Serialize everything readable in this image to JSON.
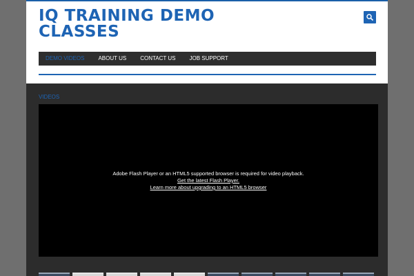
{
  "site": {
    "title": "IQ TRAINING DEMO CLASSES"
  },
  "search": {
    "icon": "search-icon"
  },
  "nav": {
    "items": [
      {
        "label": "DEMO VIDEOS",
        "active": true
      },
      {
        "label": "ABOUT US",
        "active": false
      },
      {
        "label": "CONTACT US",
        "active": false
      },
      {
        "label": "JOB SUPPORT",
        "active": false
      }
    ]
  },
  "main": {
    "section_title": "VIDEOS",
    "player": {
      "message": "Adobe Flash Player or an HTML5 supported browser is required for video playback.",
      "flash_link": "Get the latest Flash Player.",
      "html5_link": "Learn more about upgrading to an HTML5 browser"
    },
    "thumbnail_count": 10
  },
  "colors": {
    "accent": "#1e64b4",
    "nav_bg": "#2e2e2e",
    "content_bg": "#2c2c2c",
    "page_bg": "#6f6f6f"
  }
}
